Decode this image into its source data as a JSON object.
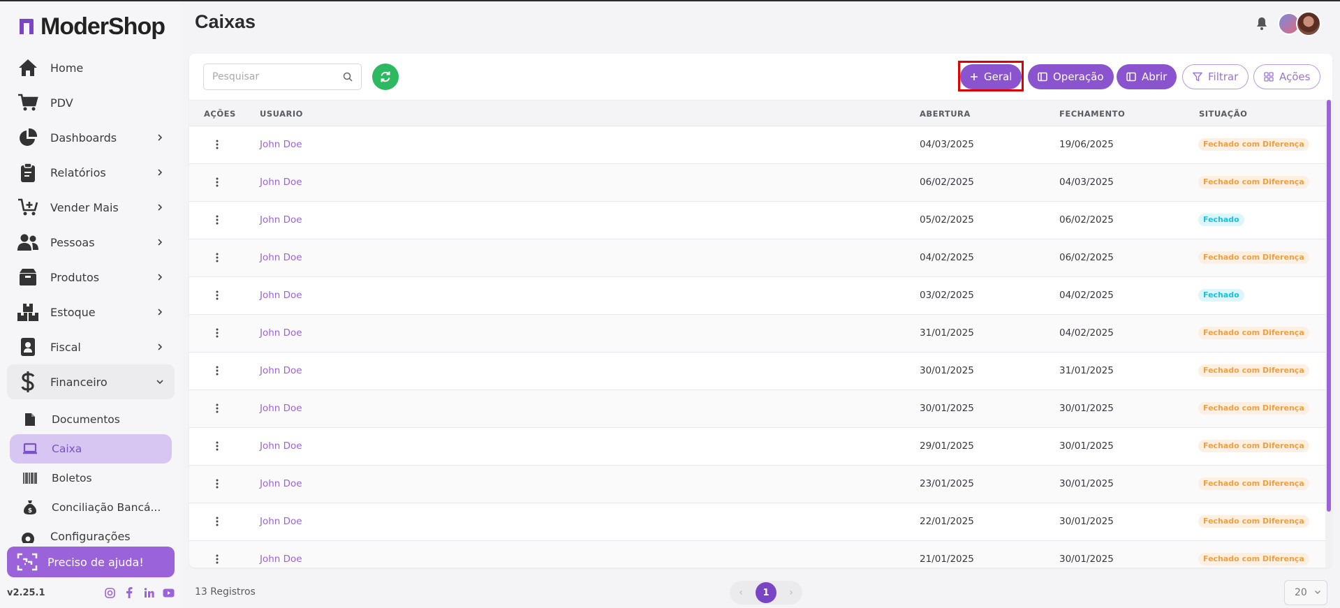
{
  "app": {
    "brand": "ModerShop",
    "version": "v2.25.1"
  },
  "sidebar": {
    "items": [
      {
        "label": "Home",
        "icon": "home-icon",
        "has_children": false
      },
      {
        "label": "PDV",
        "icon": "cart-icon",
        "has_children": false
      },
      {
        "label": "Dashboards",
        "icon": "pie-chart-icon",
        "has_children": true
      },
      {
        "label": "Relatórios",
        "icon": "clipboard-icon",
        "has_children": true
      },
      {
        "label": "Vender Mais",
        "icon": "cart-plus-icon",
        "has_children": true
      },
      {
        "label": "Pessoas",
        "icon": "people-icon",
        "has_children": true
      },
      {
        "label": "Produtos",
        "icon": "box-icon",
        "has_children": true
      },
      {
        "label": "Estoque",
        "icon": "boxes-icon",
        "has_children": true
      },
      {
        "label": "Fiscal",
        "icon": "id-badge-icon",
        "has_children": true
      },
      {
        "label": "Financeiro",
        "icon": "dollar-icon",
        "has_children": true,
        "expanded": true
      }
    ],
    "subitems": [
      {
        "label": "Documentos",
        "icon": "document-icon",
        "active": false
      },
      {
        "label": "Caixa",
        "icon": "laptop-icon",
        "active": true
      },
      {
        "label": "Boletos",
        "icon": "barcode-icon",
        "active": false
      },
      {
        "label": "Conciliação Bancá...",
        "icon": "money-bag-icon",
        "active": false
      }
    ],
    "config_label": "Configurações",
    "help_label": "Preciso de ajuda!",
    "socials": [
      "instagram-icon",
      "facebook-icon",
      "linkedin-icon",
      "youtube-icon"
    ]
  },
  "header": {
    "title": "Caixas"
  },
  "toolbar": {
    "search_placeholder": "Pesquisar",
    "geral_label": "Geral",
    "operacao_label": "Operação",
    "abrir_label": "Abrir",
    "filtrar_label": "Filtrar",
    "acoes_label": "Ações"
  },
  "table": {
    "columns": {
      "acoes": "AÇÕES",
      "usuario": "USUARIO",
      "abertura": "ABERTURA",
      "fechamento": "FECHAMENTO",
      "situacao": "SITUAÇÃO"
    },
    "rows": [
      {
        "usuario": "John Doe",
        "abertura": "04/03/2025",
        "fechamento": "19/06/2025",
        "situacao": "Fechado com Diferença",
        "status": "diff"
      },
      {
        "usuario": "John Doe",
        "abertura": "06/02/2025",
        "fechamento": "04/03/2025",
        "situacao": "Fechado com Diferença",
        "status": "diff"
      },
      {
        "usuario": "John Doe",
        "abertura": "05/02/2025",
        "fechamento": "06/02/2025",
        "situacao": "Fechado",
        "status": "ok"
      },
      {
        "usuario": "John Doe",
        "abertura": "04/02/2025",
        "fechamento": "06/02/2025",
        "situacao": "Fechado com Diferença",
        "status": "diff"
      },
      {
        "usuario": "John Doe",
        "abertura": "03/02/2025",
        "fechamento": "04/02/2025",
        "situacao": "Fechado",
        "status": "ok"
      },
      {
        "usuario": "John Doe",
        "abertura": "31/01/2025",
        "fechamento": "04/02/2025",
        "situacao": "Fechado com Diferença",
        "status": "diff"
      },
      {
        "usuario": "John Doe",
        "abertura": "30/01/2025",
        "fechamento": "31/01/2025",
        "situacao": "Fechado com Diferença",
        "status": "diff"
      },
      {
        "usuario": "John Doe",
        "abertura": "30/01/2025",
        "fechamento": "30/01/2025",
        "situacao": "Fechado com Diferença",
        "status": "diff"
      },
      {
        "usuario": "John Doe",
        "abertura": "29/01/2025",
        "fechamento": "30/01/2025",
        "situacao": "Fechado com Diferença",
        "status": "diff"
      },
      {
        "usuario": "John Doe",
        "abertura": "23/01/2025",
        "fechamento": "30/01/2025",
        "situacao": "Fechado com Diferença",
        "status": "diff"
      },
      {
        "usuario": "John Doe",
        "abertura": "22/01/2025",
        "fechamento": "30/01/2025",
        "situacao": "Fechado com Diferença",
        "status": "diff"
      },
      {
        "usuario": "John Doe",
        "abertura": "21/01/2025",
        "fechamento": "30/01/2025",
        "situacao": "Fechado com Diferença",
        "status": "diff"
      }
    ]
  },
  "footer": {
    "records_label": "13 Registros",
    "current_page": "1",
    "per_page": "20"
  },
  "colors": {
    "accent": "#8a54cf",
    "refresh": "#2cb95f",
    "status_diff": "#f0a040",
    "status_ok": "#1cc0de",
    "highlight": "#e00000"
  }
}
